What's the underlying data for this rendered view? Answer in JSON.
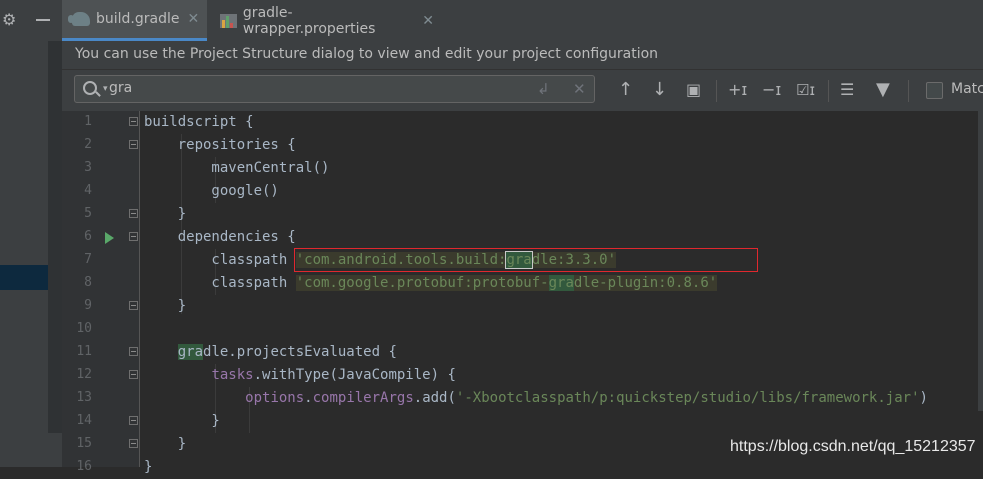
{
  "tabs": [
    {
      "label": "build.gradle",
      "icon": "gradle-icon",
      "active": true
    },
    {
      "label": "gradle-wrapper.properties",
      "icon": "properties-icon",
      "active": false
    }
  ],
  "tab_close_glyph": "✕",
  "banner": {
    "text": "You can use the Project Structure dialog to view and edit your project configuration"
  },
  "search": {
    "value": "gra",
    "match_case_label": "Matc"
  },
  "toolbar_icons": [
    "previous-occurrence-icon",
    "next-occurrence-icon",
    "filter-search-results-icon",
    "add-selection-next-icon",
    "unselect-occurrence-icon",
    "select-all-occurrences-icon",
    "show-filter-popup-icon",
    "filter-icon"
  ],
  "line_numbers": [
    "1",
    "2",
    "3",
    "4",
    "5",
    "6",
    "7",
    "8",
    "9",
    "10",
    "11",
    "12",
    "13",
    "14",
    "15",
    "16"
  ],
  "code": {
    "l1": "buildscript {",
    "l2": "    repositories {",
    "l3": "        mavenCentral()",
    "l4": "        google()",
    "l5": "    }",
    "l6": "    dependencies {",
    "l7_kw": "        classpath ",
    "l7_str_a": "'com.android.tools.build:",
    "l7_hit": "gra",
    "l7_str_b": "dle:3.3.0'",
    "l8_kw": "        classpath ",
    "l8_str_a": "'com.google.protobuf:protobuf-",
    "l8_hit": "gra",
    "l8_str_b": "dle-plugin:0.8.6'",
    "l9": "    }",
    "l10": "",
    "l11_hit": "gra",
    "l11_rest": "dle.projectsEvaluated {",
    "l11_indent": "    ",
    "l12_fld": "tasks",
    "l12_rest": ".withType(JavaCompile) {",
    "l12_indent": "        ",
    "l13_indent": "            ",
    "l13_fld1": "options",
    "l13_dot": ".",
    "l13_fld2": "compilerArgs",
    "l13_call": ".add(",
    "l13_str": "'-Xbootclasspath/p:quickstep/studio/libs/framework.jar'",
    "l13_close": ")",
    "l14": "        }",
    "l15": "    }",
    "l16": "}"
  },
  "watermark": "https://blog.csdn.net/qq_15212357"
}
